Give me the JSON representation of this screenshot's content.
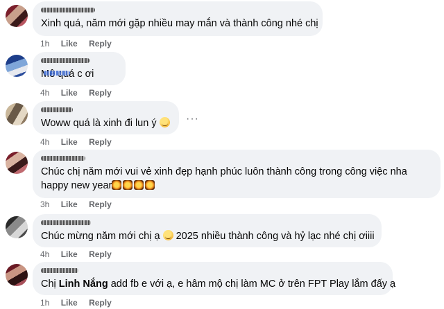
{
  "comments": [
    {
      "text": "Xinh quá, năm mới gặp nhiều may mắn và thành công nhé chị",
      "time": "1h",
      "like": "Like",
      "reply": "Reply"
    },
    {
      "text": "Mê quá c ơi",
      "time": "4h",
      "like": "Like",
      "reply": "Reply"
    },
    {
      "text": "Woww quá là xinh đi lun ý",
      "time": "4h",
      "like": "Like",
      "reply": "Reply"
    },
    {
      "line1": "Chúc chị năm mới vui vẻ xinh đẹp hạnh phúc luôn thành công trong công việc nha",
      "line2": "happy new year",
      "time": "3h",
      "like": "Like",
      "reply": "Reply"
    },
    {
      "text_before": "Chúc mừng năm mới chị ạ",
      "text_after": "2025 nhiều thành công và hỷ lạc nhé chị ơiiii",
      "time": "4h",
      "like": "Like",
      "reply": "Reply"
    },
    {
      "prefix": "Chị",
      "mention": "Linh Nắng",
      "rest": "add fb e với ạ, e hâm mộ chị làm MC ở trên FPT Play lắm đấy ạ",
      "time": "1h",
      "like": "Like",
      "reply": "Reply"
    }
  ],
  "more_options": "···",
  "colors": {
    "bubble": "#f0f2f5",
    "meta": "#65676b",
    "text": "#050505"
  },
  "icons": [
    "avatar",
    "smiling-face-emoji",
    "firework-emoji",
    "hugging-face-emoji",
    "more-options-icon"
  ]
}
